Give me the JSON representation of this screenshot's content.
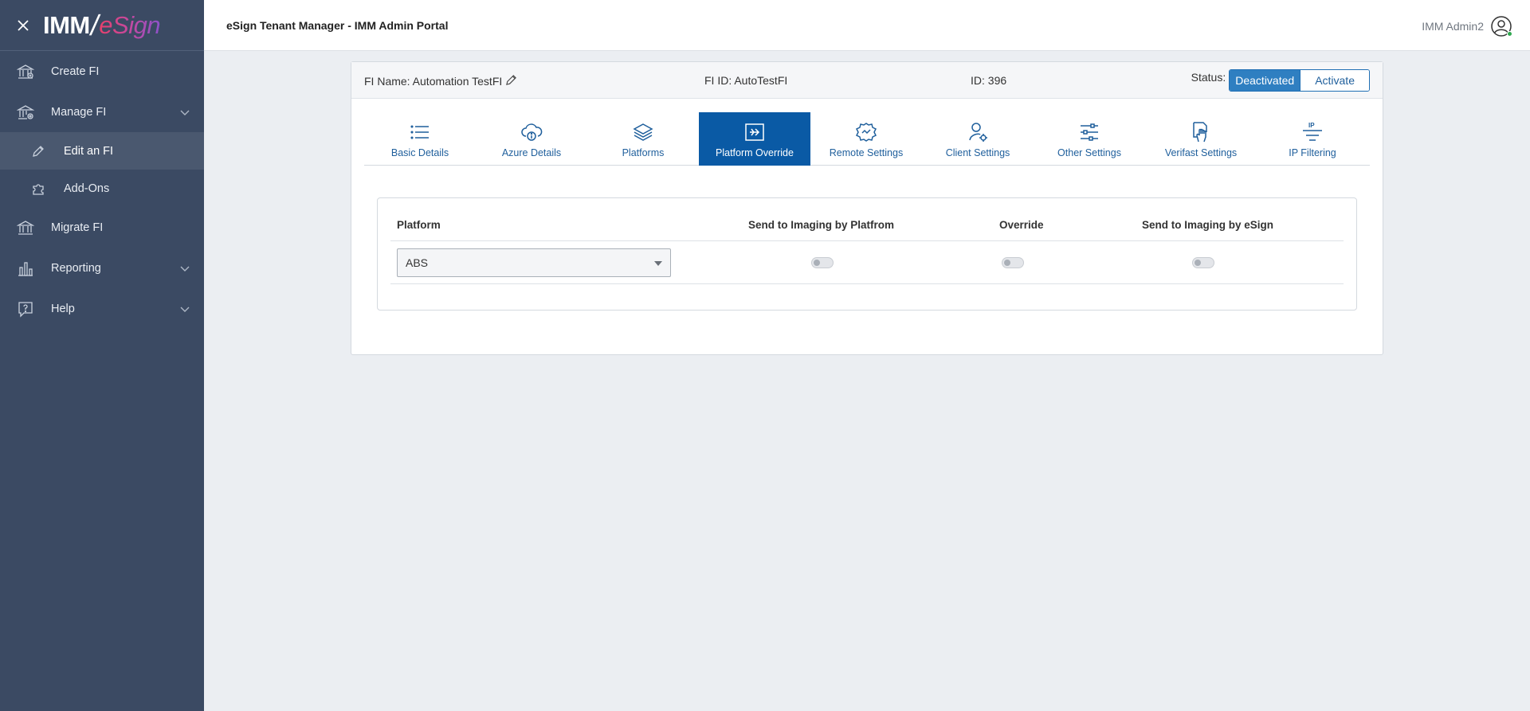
{
  "brand": {
    "part1": "IMM",
    "part2": "eSign"
  },
  "sidebar": {
    "items": [
      {
        "label": "Create FI",
        "icon": "bank-icon"
      },
      {
        "label": "Manage FI",
        "icon": "bank-settings-icon"
      },
      {
        "label": "Edit an FI",
        "icon": "pencil-icon"
      },
      {
        "label": "Add-Ons",
        "icon": "puzzle-icon"
      },
      {
        "label": "Migrate FI",
        "icon": "bank-migrate-icon"
      },
      {
        "label": "Reporting",
        "icon": "bar-chart-icon"
      },
      {
        "label": "Help",
        "icon": "help-icon"
      }
    ]
  },
  "header": {
    "title": "eSign Tenant Manager - IMM Admin Portal",
    "user": "IMM Admin2"
  },
  "fi": {
    "name": "FI Name: Automation TestFI",
    "fi_id": "FI ID: AutoTestFI",
    "id": "ID: 396",
    "status_label": "Status:",
    "status_on": "Deactivated",
    "status_off": "Activate"
  },
  "tabs": [
    {
      "label": "Basic Details",
      "icon": "list-icon"
    },
    {
      "label": "Azure Details",
      "icon": "cloud-info-icon"
    },
    {
      "label": "Platforms",
      "icon": "layers-icon"
    },
    {
      "label": "Platform Override",
      "icon": "override-arrow-icon",
      "active": true
    },
    {
      "label": "Remote Settings",
      "icon": "remote-gear-icon"
    },
    {
      "label": "Client Settings",
      "icon": "user-gear-icon"
    },
    {
      "label": "Other Settings",
      "icon": "sliders-icon"
    },
    {
      "label": "Verifast Settings",
      "icon": "hand-document-icon"
    },
    {
      "label": "IP Filtering",
      "icon": "ip-filter-icon"
    }
  ],
  "table": {
    "headers": {
      "platform": "Platform",
      "send_platform": "Send to Imaging by Platfrom",
      "override": "Override",
      "send_esign": "Send to Imaging by eSign"
    },
    "rows": [
      {
        "platform": "ABS",
        "send_platform": false,
        "override": false,
        "send_esign": false
      }
    ]
  },
  "colors": {
    "sidebar_bg": "#3b4a63",
    "accent": "#0a5aa5",
    "status_active": "#2f7fc1"
  }
}
